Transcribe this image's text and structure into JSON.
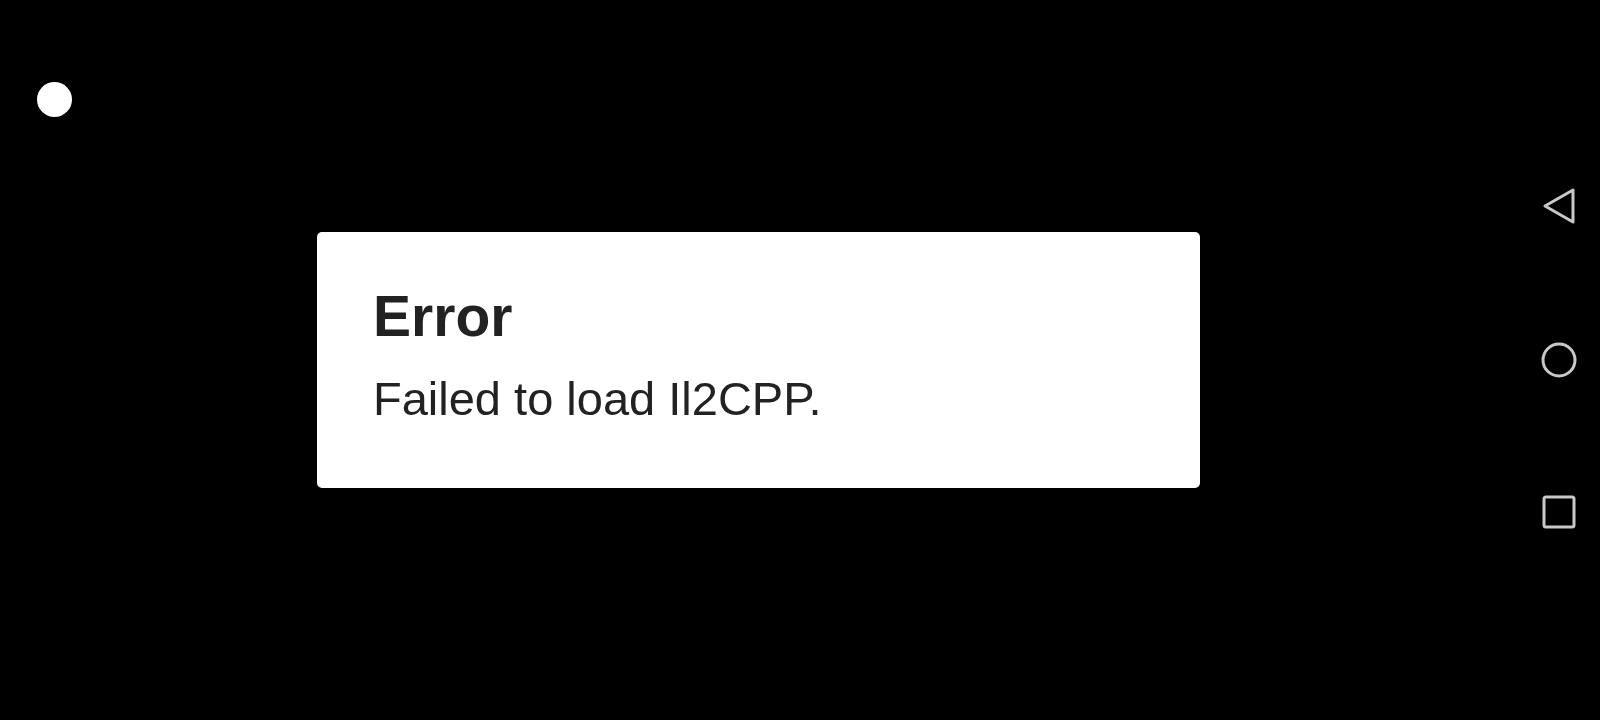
{
  "dialog": {
    "title": "Error",
    "message": "Failed to load Il2CPP."
  },
  "navigation_bar": [
    {
      "kind": "back"
    },
    {
      "kind": "home"
    },
    {
      "kind": "recents"
    }
  ]
}
